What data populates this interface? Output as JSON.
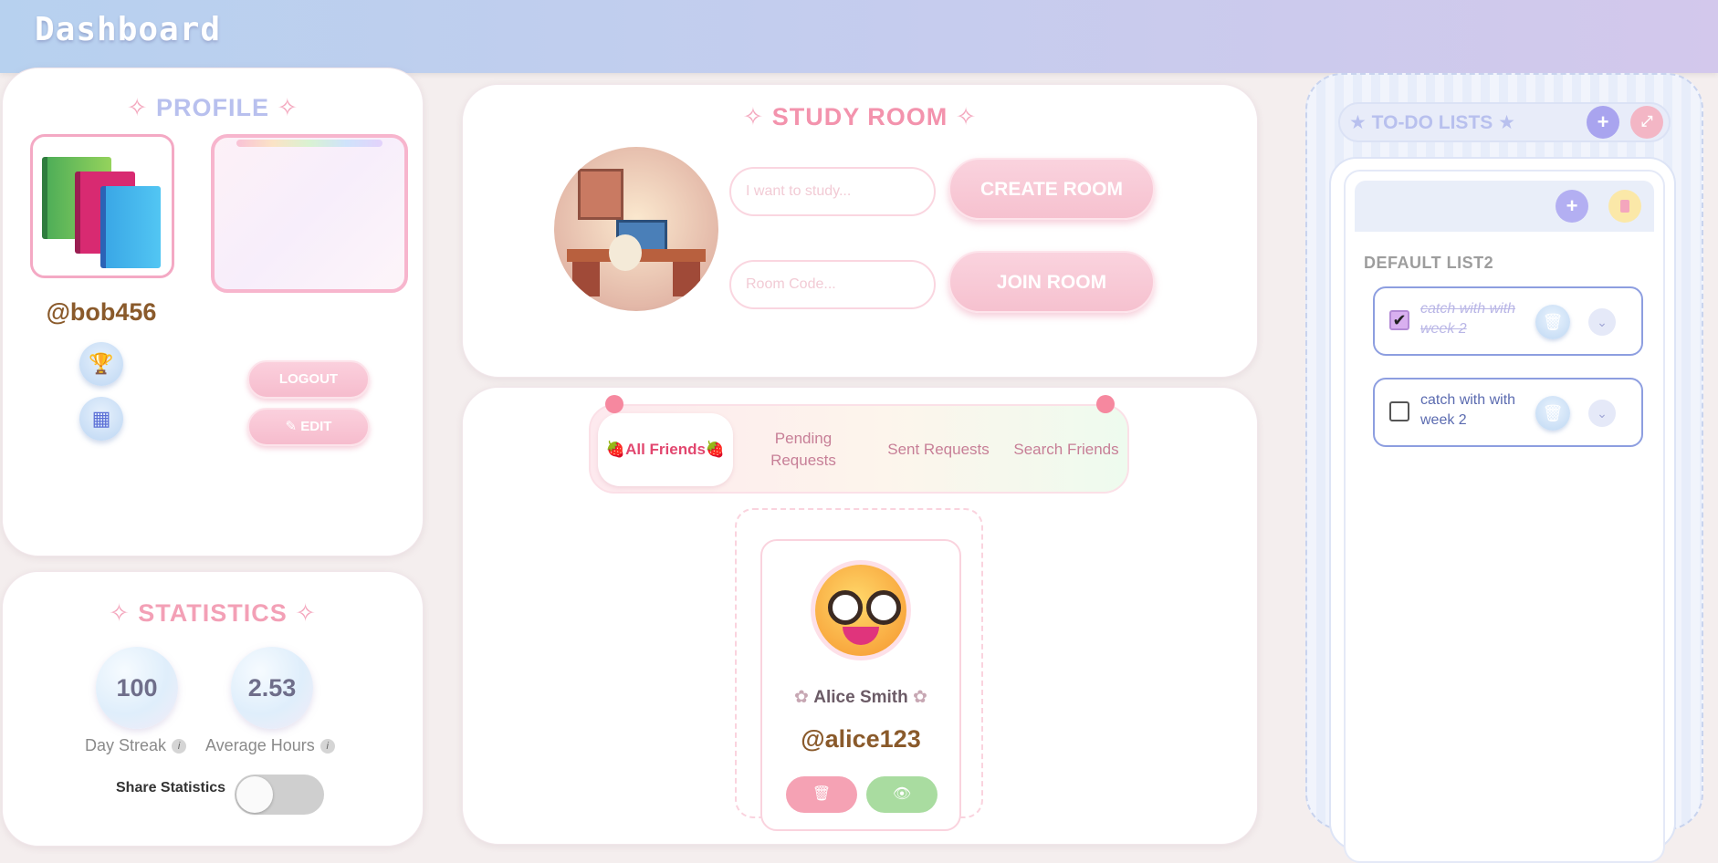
{
  "header": {
    "title": "Dashboard"
  },
  "profile": {
    "title": "PROFILE",
    "username": "@bob456",
    "logout_label": "LOGOUT",
    "edit_label": "✎ EDIT",
    "trophy_icon": "trophy-icon",
    "calendar_icon": "calendar-icon"
  },
  "statistics": {
    "title": "STATISTICS",
    "day_streak_value": "100",
    "day_streak_label": "Day Streak",
    "avg_hours_value": "2.53",
    "avg_hours_label": "Average Hours",
    "info_glyph": "i",
    "share_label": "Share Statistics",
    "share_enabled": false
  },
  "study_room": {
    "title": "STUDY ROOM",
    "study_placeholder": "I want to study...",
    "room_code_placeholder": "Room Code...",
    "create_label": "CREATE ROOM",
    "join_label": "JOIN ROOM"
  },
  "friends": {
    "tabs": [
      {
        "label": "🍓All Friends🍓",
        "active": true
      },
      {
        "label": "Pending Requests",
        "active": false
      },
      {
        "label": "Sent Requests",
        "active": false
      },
      {
        "label": "Search Friends",
        "active": false
      }
    ],
    "friend": {
      "name": "Alice Smith",
      "handle": "@alice123"
    }
  },
  "todo": {
    "title": "★ TO-DO LISTS ★",
    "list_name": "DEFAULT LIST2",
    "items": [
      {
        "text": "catch with with week 2",
        "done": true
      },
      {
        "text": "catch with with week 2",
        "done": false
      }
    ]
  },
  "colors": {
    "accent_pink": "#f3a0b6",
    "profile_title": "#b8c0ee",
    "username": "#8a5a2b",
    "todo_border": "#8d9ee0"
  }
}
